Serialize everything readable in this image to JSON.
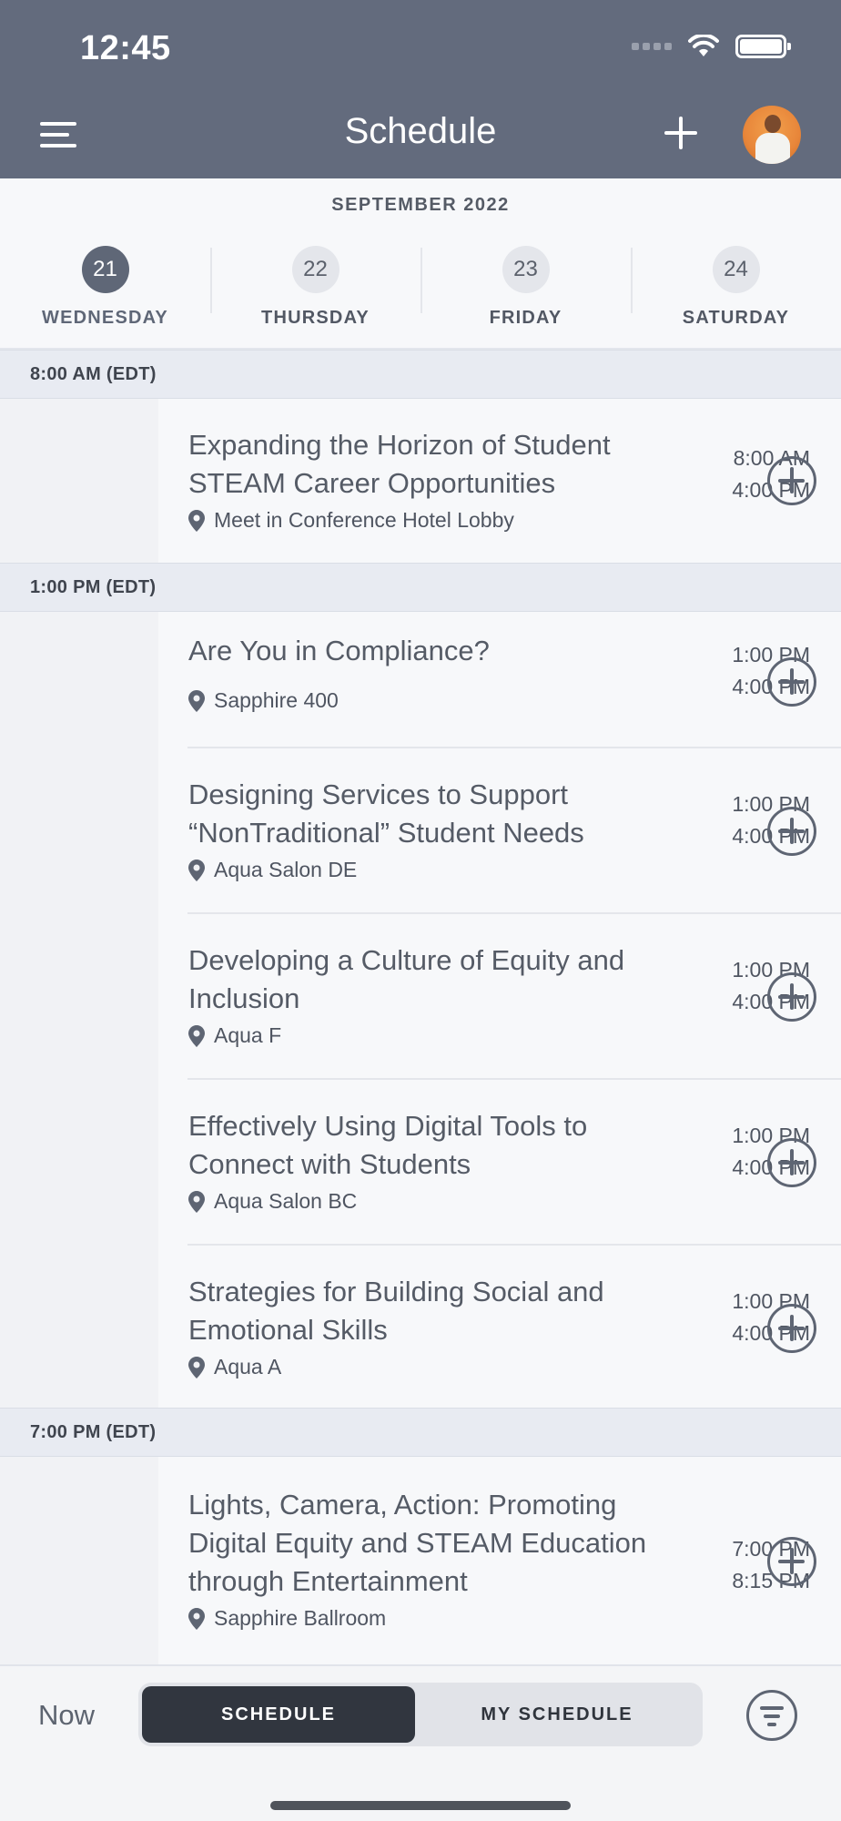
{
  "status_bar": {
    "time": "12:45"
  },
  "header": {
    "title": "Schedule",
    "menu_icon": "hamburger-icon",
    "add_icon": "plus-icon",
    "avatar": "user-avatar"
  },
  "calendar": {
    "month": "SEPTEMBER 2022",
    "days": [
      {
        "num": "21",
        "label": "WEDNESDAY",
        "selected": true
      },
      {
        "num": "22",
        "label": "THURSDAY",
        "selected": false
      },
      {
        "num": "23",
        "label": "FRIDAY",
        "selected": false
      },
      {
        "num": "24",
        "label": "SATURDAY",
        "selected": false
      }
    ]
  },
  "sections": [
    {
      "label": "8:00 AM (EDT)"
    },
    {
      "label": "1:00 PM (EDT)"
    },
    {
      "label": "7:00 PM (EDT)"
    }
  ],
  "events": [
    {
      "start": "8:00 AM",
      "end": "4:00 PM",
      "title": "Expanding the Horizon of Student STEAM Career Opportunities",
      "location": "Meet in Conference Hotel Lobby"
    },
    {
      "start": "1:00 PM",
      "end": "4:00 PM",
      "title": "Are You in Compliance?",
      "location": "Sapphire 400"
    },
    {
      "start": "1:00 PM",
      "end": "4:00 PM",
      "title": "Designing Services to Support “NonTraditional” Student Needs",
      "location": "Aqua Salon DE"
    },
    {
      "start": "1:00 PM",
      "end": "4:00 PM",
      "title": "Developing a Culture of Equity and Inclusion",
      "location": "Aqua F"
    },
    {
      "start": "1:00 PM",
      "end": "4:00 PM",
      "title": "Effectively Using Digital Tools to Connect with Students",
      "location": "Aqua Salon BC"
    },
    {
      "start": "1:00 PM",
      "end": "4:00 PM",
      "title": "Strategies for Building Social and Emotional Skills",
      "location": "Aqua A"
    },
    {
      "start": "7:00 PM",
      "end": "8:15 PM",
      "title": "Lights, Camera, Action: Promoting Digital Equity and STEAM Education through Entertainment",
      "location": "Sapphire Ballroom"
    }
  ],
  "bottom_bar": {
    "now_label": "Now",
    "tabs": [
      {
        "label": "SCHEDULE",
        "selected": true
      },
      {
        "label": "MY SCHEDULE",
        "selected": false
      }
    ],
    "filter_icon": "filter-icon"
  },
  "colors": {
    "header_bg": "#636b7d",
    "selected_day": "#5f6777",
    "section_bg": "#e8ebf2",
    "active_tab": "#31363f"
  }
}
